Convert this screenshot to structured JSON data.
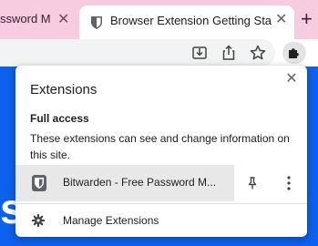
{
  "tabs": [
    {
      "title": "ssword M",
      "active": false
    },
    {
      "title": "Browser Extension Getting Sta",
      "active": true
    }
  ],
  "new_tab_glyph": "+",
  "close_glyph": "✕",
  "toolbar_icons": [
    "download-icon",
    "share-icon",
    "star-icon",
    "puzzle-extensions-icon"
  ],
  "page": {
    "visible_letter": "s"
  },
  "popup": {
    "title": "Extensions",
    "section_heading": "Full access",
    "section_desc": "These extensions can see and change information on this site.",
    "extension": {
      "name": "Bitwarden - Free Password M..."
    },
    "manage_label": "Manage Extensions"
  },
  "colors": {
    "tabstrip": "#f7cbe0",
    "page_bg": "#0d61ee",
    "row_highlight": "#e8e8e8"
  }
}
